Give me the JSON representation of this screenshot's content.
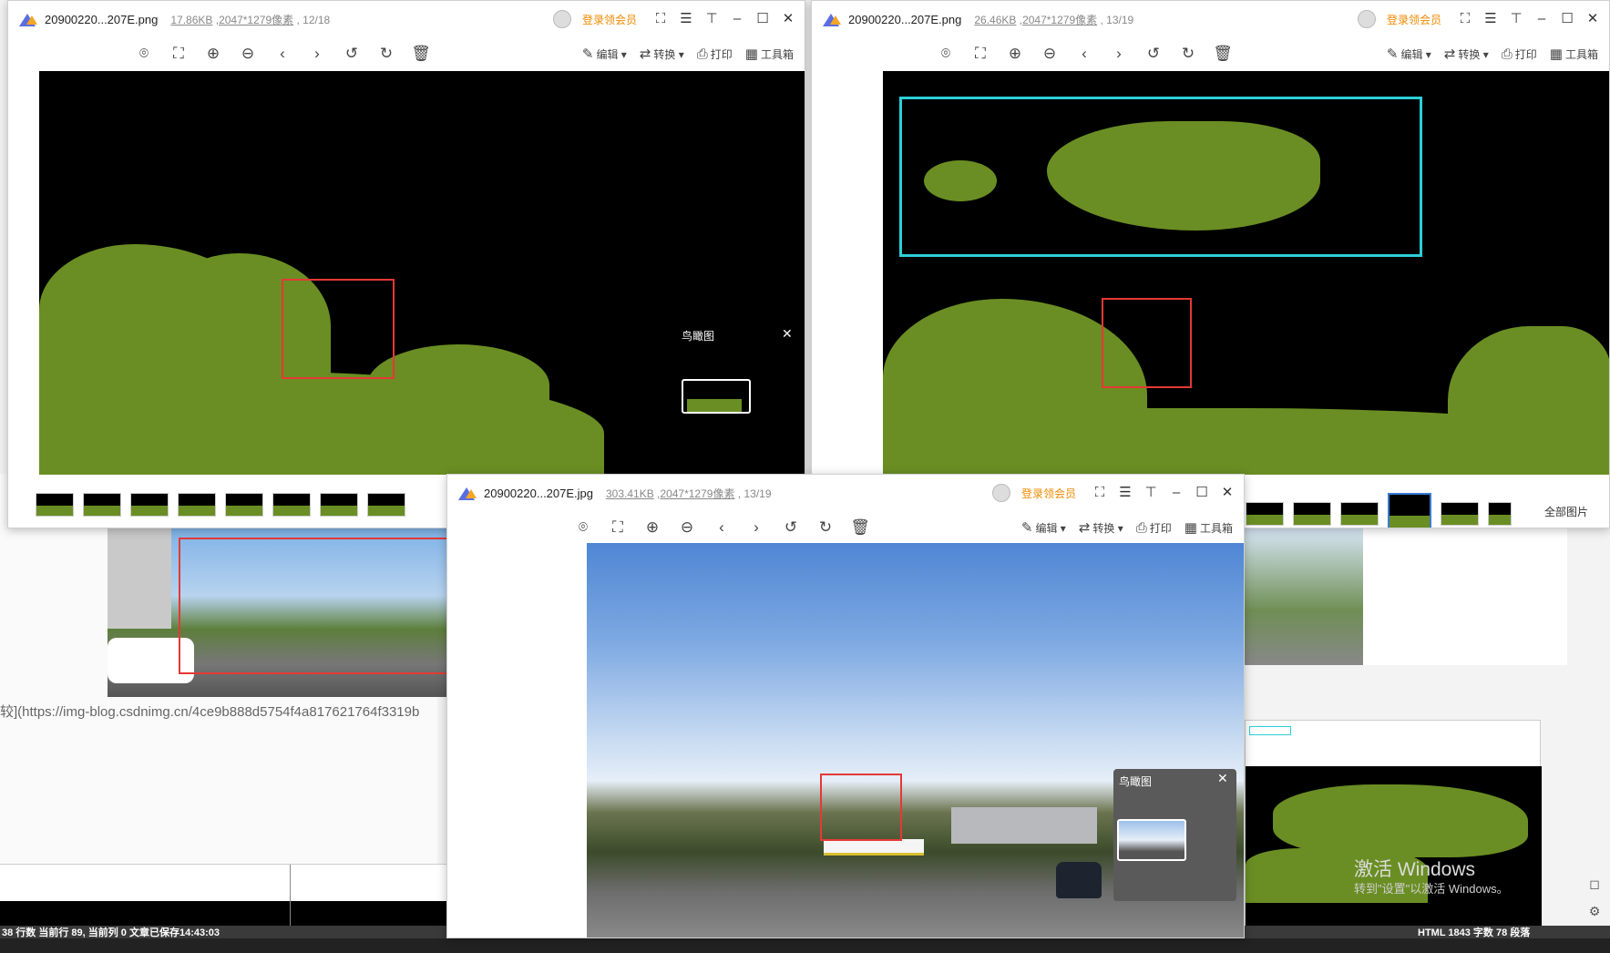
{
  "window_a": {
    "filename": "20900220...207E.png",
    "size": "17.86KB",
    "dims": "2047*1279像素",
    "index": "12/18",
    "vip": "登录领会员",
    "tools": {
      "edit": "编辑",
      "convert": "转换",
      "print": "打印",
      "toolbox": "工具箱"
    },
    "birdseye_title": "鸟瞰图"
  },
  "window_b": {
    "filename": "20900220...207E.png",
    "size": "26.46KB",
    "dims": "2047*1279像素",
    "index": "13/19",
    "vip": "登录领会员",
    "tools": {
      "edit": "编辑",
      "convert": "转换",
      "print": "打印",
      "toolbox": "工具箱"
    },
    "all_images": "全部图片"
  },
  "window_c": {
    "filename": "20900220...207E.jpg",
    "size": "303.41KB",
    "dims": "2047*1279像素",
    "index": "13/19",
    "vip": "登录领会员",
    "tools": {
      "edit": "编辑",
      "convert": "转换",
      "print": "打印",
      "toolbox": "工具箱"
    },
    "birdseye_title": "鸟瞰图"
  },
  "background": {
    "url_text": "较](https://img-blog.csdnimg.cn/4ce9b888d5754f4a817621764f3319b",
    "status_left": "38 行数  当前行 89, 当前列 0  文章已保存14:43:03",
    "status_right": "HTML  1843 字数  78 段落",
    "activate_title": "激活 Windows",
    "activate_sub": "转到\"设置\"以激活 Windows。"
  },
  "colors": {
    "vegetation": "#6a8e23",
    "red_box": "#e53935",
    "cyan_box": "#2ccfd6",
    "vip": "#f08a00"
  }
}
